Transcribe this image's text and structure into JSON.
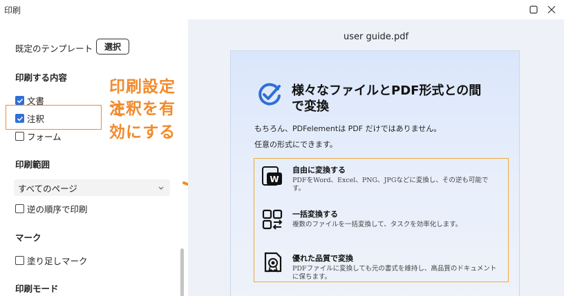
{
  "window": {
    "title": "印刷"
  },
  "settings": {
    "template_label": "既定のテンプレート",
    "select_button": "選択",
    "print_content": {
      "heading": "印刷する内容",
      "items": [
        {
          "label": "文書",
          "checked": true
        },
        {
          "label": "注釈",
          "checked": true
        },
        {
          "label": "フォーム",
          "checked": false
        }
      ]
    },
    "print_range": {
      "heading": "印刷範囲",
      "selected": "すべてのページ",
      "reverse_label": "逆の順序で印刷",
      "reverse_checked": false
    },
    "marks": {
      "heading": "マーク",
      "bleed_label": "塗り足しマーク",
      "bleed_checked": false
    },
    "print_mode": {
      "heading": "印刷モード"
    }
  },
  "annotation": {
    "line1": "印刷設定で",
    "line2": "注釈を有効にする",
    "color": "#f28a2c"
  },
  "preview": {
    "file_name": "user guide.pdf",
    "heading_line1": "様々なファイルとPDF形式との間",
    "heading_line2": "で変換",
    "para1": "もちろん、PDFelementは PDF だけではありません。",
    "para2": "任意の形式にできます。",
    "features": [
      {
        "icon": "word-icon",
        "title": "自由に変換する",
        "desc": "PDFをWord、Excel、PNG、JPGなどに変換し、その逆も可能です。"
      },
      {
        "icon": "batch-icon",
        "title": "一括変換する",
        "desc": "複数のファイルを一括変換して、タスクを効率化します。"
      },
      {
        "icon": "quality-badge-icon",
        "title": "優れた品質で変換",
        "desc": "PDFファイルに変換しても元の書式を維持し、高品質のドキュメントに保ちます。"
      }
    ]
  },
  "colors": {
    "accent_blue": "#2f6fd6",
    "highlight_orange": "#f28a2c"
  }
}
